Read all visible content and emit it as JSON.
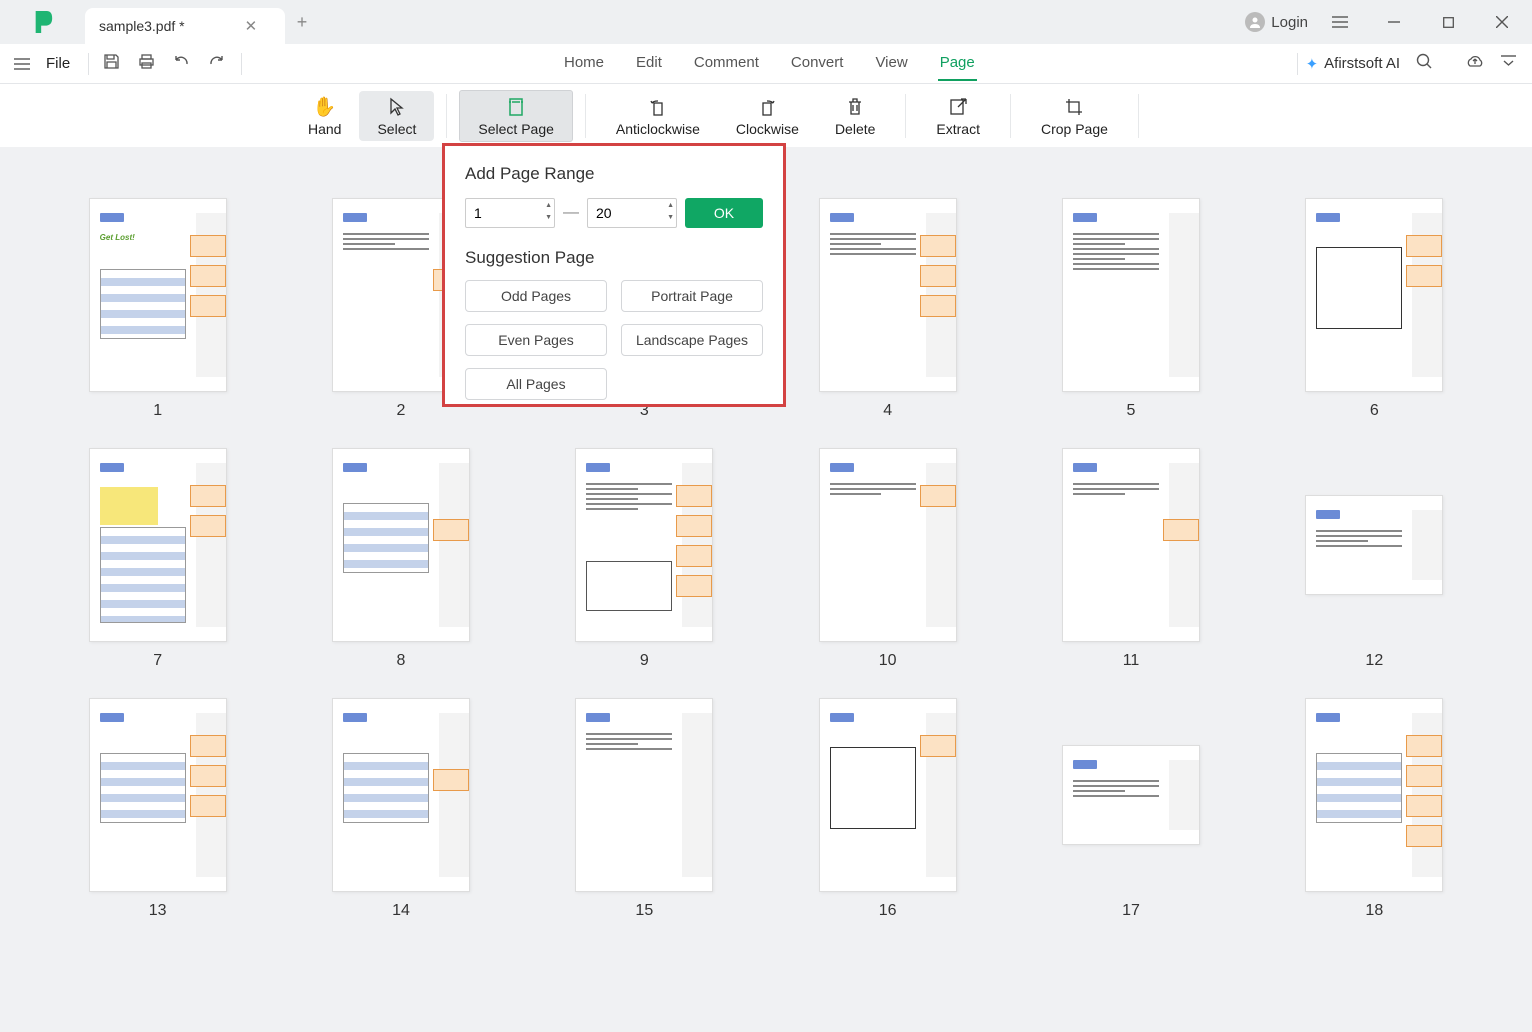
{
  "tab": {
    "title": "sample3.pdf *"
  },
  "login_label": "Login",
  "file_menu": "File",
  "main_menu": [
    "Home",
    "Edit",
    "Comment",
    "Convert",
    "View",
    "Page"
  ],
  "main_menu_active": "Page",
  "ai_label": "Afirstsoft AI",
  "tools": {
    "hand": "Hand",
    "select": "Select",
    "select_page": "Select Page",
    "anticlockwise": "Anticlockwise",
    "clockwise": "Clockwise",
    "delete": "Delete",
    "extract": "Extract",
    "crop_page": "Crop Page"
  },
  "popup": {
    "title": "Add Page Range",
    "from": "1",
    "to": "20",
    "ok": "OK",
    "suggestion_title": "Suggestion Page",
    "buttons": {
      "odd": "Odd Pages",
      "portrait": "Portrait Page",
      "even": "Even Pages",
      "landscape": "Landscape Pages",
      "all": "All Pages"
    }
  },
  "pages": [
    {
      "num": "1",
      "layout": "portrait"
    },
    {
      "num": "2",
      "layout": "portrait"
    },
    {
      "num": "3",
      "layout": "portrait"
    },
    {
      "num": "4",
      "layout": "portrait"
    },
    {
      "num": "5",
      "layout": "portrait"
    },
    {
      "num": "6",
      "layout": "portrait"
    },
    {
      "num": "7",
      "layout": "portrait"
    },
    {
      "num": "8",
      "layout": "portrait"
    },
    {
      "num": "9",
      "layout": "portrait"
    },
    {
      "num": "10",
      "layout": "portrait"
    },
    {
      "num": "11",
      "layout": "portrait"
    },
    {
      "num": "12",
      "layout": "landscape"
    },
    {
      "num": "13",
      "layout": "portrait"
    },
    {
      "num": "14",
      "layout": "portrait"
    },
    {
      "num": "15",
      "layout": "portrait"
    },
    {
      "num": "16",
      "layout": "portrait"
    },
    {
      "num": "17",
      "layout": "landscape"
    },
    {
      "num": "18",
      "layout": "portrait"
    }
  ]
}
